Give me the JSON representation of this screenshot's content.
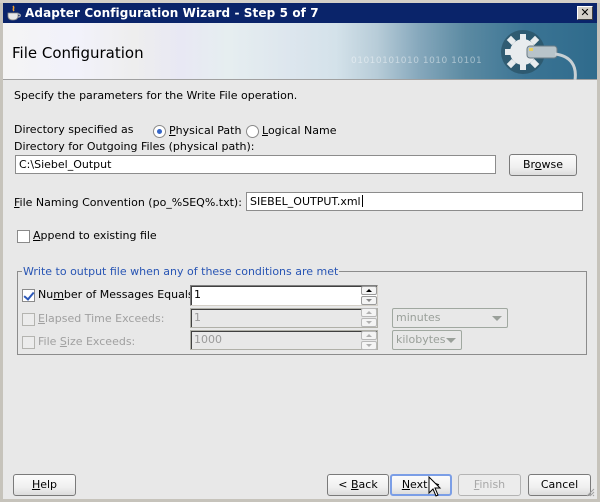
{
  "window": {
    "title": "Adapter Configuration Wizard - Step 5 of 7",
    "close_label": "✕"
  },
  "banner": {
    "heading": "File Configuration",
    "binary_text": "01010101010  1010 10101"
  },
  "description": "Specify the parameters for the Write File operation.",
  "directory": {
    "spec_label": "Directory specified as",
    "radio_physical": {
      "label_first": "P",
      "label_rest": "hysical Path",
      "checked": true
    },
    "radio_logical": {
      "label_first": "L",
      "label_rest": "ogical Name",
      "checked": false
    },
    "outgoing_label": "Directory for Outgoing Files (physical path):",
    "outgoing_value": "C:\\Siebel_Output",
    "browse_first": "Br",
    "browse_u": "o",
    "browse_rest": "wse"
  },
  "naming": {
    "label_u": "F",
    "label_rest": "ile Naming Convention (po_%SEQ%.txt):",
    "value": "SIEBEL_OUTPUT.xml"
  },
  "append": {
    "label_u": "A",
    "label_rest": "ppend to existing file",
    "checked": false
  },
  "conditions": {
    "group_title": "Write to output file when any of these conditions are met",
    "messages": {
      "label_pre": "Nu",
      "label_u": "m",
      "label_rest": "ber of Messages Equals:",
      "checked": true,
      "value": "1"
    },
    "elapsed": {
      "label_u": "E",
      "label_rest": "lapsed Time Exceeds:",
      "checked": false,
      "value": "1",
      "unit": "minutes"
    },
    "filesize": {
      "label_pre": "File ",
      "label_u": "S",
      "label_rest": "ize Exceeds:",
      "checked": false,
      "value": "1000",
      "unit": "kilobytes"
    }
  },
  "footer": {
    "help_u": "H",
    "help_rest": "elp",
    "back_pre": "< ",
    "back_u": "B",
    "back_rest": "ack",
    "next_u": "N",
    "next_rest": "ext >",
    "finish_u": "F",
    "finish_rest": "inish",
    "cancel": "Cancel"
  }
}
